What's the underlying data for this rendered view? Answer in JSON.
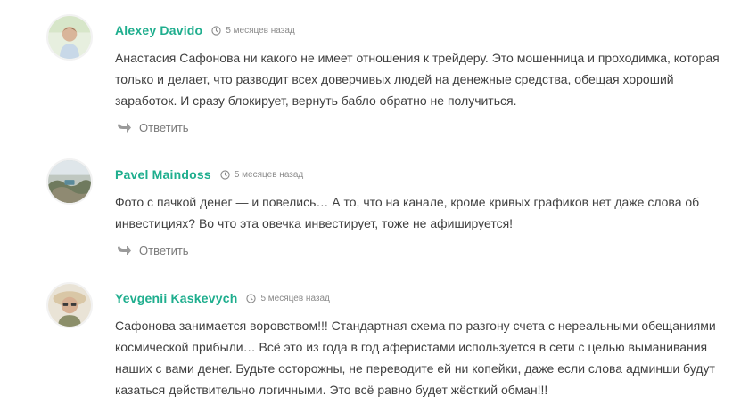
{
  "comments": [
    {
      "author": "Alexey Davido",
      "time": "5 месяцев назад",
      "text": "Анастасия Сафонова ни какого не имеет отношения к трейдеру. Это мошенница и проходимка, которая только и делает, что разводит всех доверчивых людей на денежные средства, обещая хороший заработок. И сразу блокирует, вернуть бабло обратно не получиться.",
      "reply_label": "Ответить"
    },
    {
      "author": "Pavel Maindoss",
      "time": "5 месяцев назад",
      "text": "Фото с пачкой денег — и повелись… А то, что на канале, кроме кривых графиков нет даже слова об инвестициях? Во что эта овечка инвестирует, тоже не афишируется!",
      "reply_label": "Ответить"
    },
    {
      "author": "Yevgenii Kaskevych",
      "time": "5 месяцев назад",
      "text": "Сафонова занимается воровством!!! Стандартная схема по разгону счета с нереальными обещаниями космической прибыли… Всё это из года в год аферистами используется в сети с целью выманивания наших с вами денег. Будьте осторожны, не переводите ей ни копейки, даже если слова админши будут казаться действительно логичными. Это всё равно будет жёсткий обман!!!"
    }
  ],
  "colors": {
    "author": "#1fae8e",
    "text": "#404040",
    "meta": "#8a8a8a",
    "reply": "#7b7b7b"
  },
  "icons": {
    "time": "clock-icon",
    "reply": "reply-arrow-icon"
  }
}
